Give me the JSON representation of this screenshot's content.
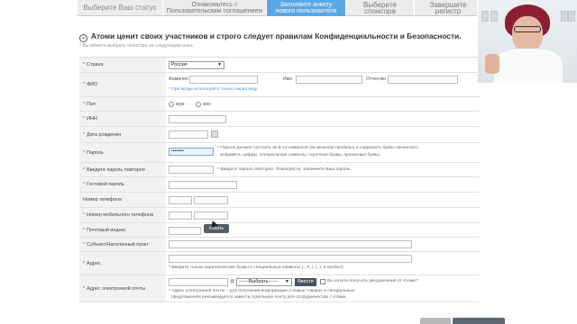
{
  "tabs": [
    {
      "label": "Выберите Ваш статус"
    },
    {
      "label": "Ознакомьтесь с\nПользовательским соглашением"
    },
    {
      "label": "Заполните анкету\nнового пользователя"
    },
    {
      "label": "Выберите спонсора"
    },
    {
      "label": "Завершите регистр"
    }
  ],
  "active_tab": 2,
  "notice": {
    "title": "Атоми ценит своих участников и строго следует правилам Конфиденциальности и Безопасности.",
    "subtitle": "* Вы можете выбрать спонсора на следующем шаге."
  },
  "form": {
    "country": {
      "label": "Страна",
      "value": "Россия"
    },
    "fio": {
      "label": "ФИО",
      "last_name_label": "Фамилия",
      "first_name_label": "Имя",
      "patronymic_label": "Отчество",
      "hint": "* При вводе используйте только кириллицу."
    },
    "gender": {
      "label": "Пол",
      "male": "муж",
      "female": "жен"
    },
    "inn": {
      "label": "ИНН"
    },
    "birthdate": {
      "label": "Дата рождения"
    },
    "password": {
      "label": "Пароль",
      "value": "••••••••",
      "hint_line1": "* Пароль должен состоять из 6-14 символов (не включая пробелы) и содержать буквы латинского",
      "hint_line2": "алфавита, цифры, специальные символы, строчные буквы, прописные буквы."
    },
    "password_repeat": {
      "label": "Введите пароль повторно",
      "hint": "* Введите пароль повторно. Пожалуйста, запомните Ваш пароль."
    },
    "guest_password": {
      "label": "Гостевой пароль"
    },
    "phone": {
      "label": "Номер телефона"
    },
    "mobile": {
      "label": "Номер мобильного телефона"
    },
    "postcode": {
      "label": "Почтовый индекс",
      "search_button": "Искать"
    },
    "region": {
      "label": "Субъект/Населенный пункт"
    },
    "address": {
      "label": "Адрес",
      "hint": "* Введите только кириллические буквы и специальные символы (-, #, /, (, ), и пробел)."
    },
    "email": {
      "label": "Адрес электронной почты",
      "at": "@",
      "domain_select": "------Выбрать------",
      "enter_button": "Ввести",
      "notify_checkbox": "Вы хотите получать уведомления от Атоми?",
      "hint_line1": "* Адрес электронной почты – для получения информации о новых товарах и специальных",
      "hint_line2": "предложениях рекомендуется завести отдельную почту для сотрудничества с Атоми."
    }
  }
}
